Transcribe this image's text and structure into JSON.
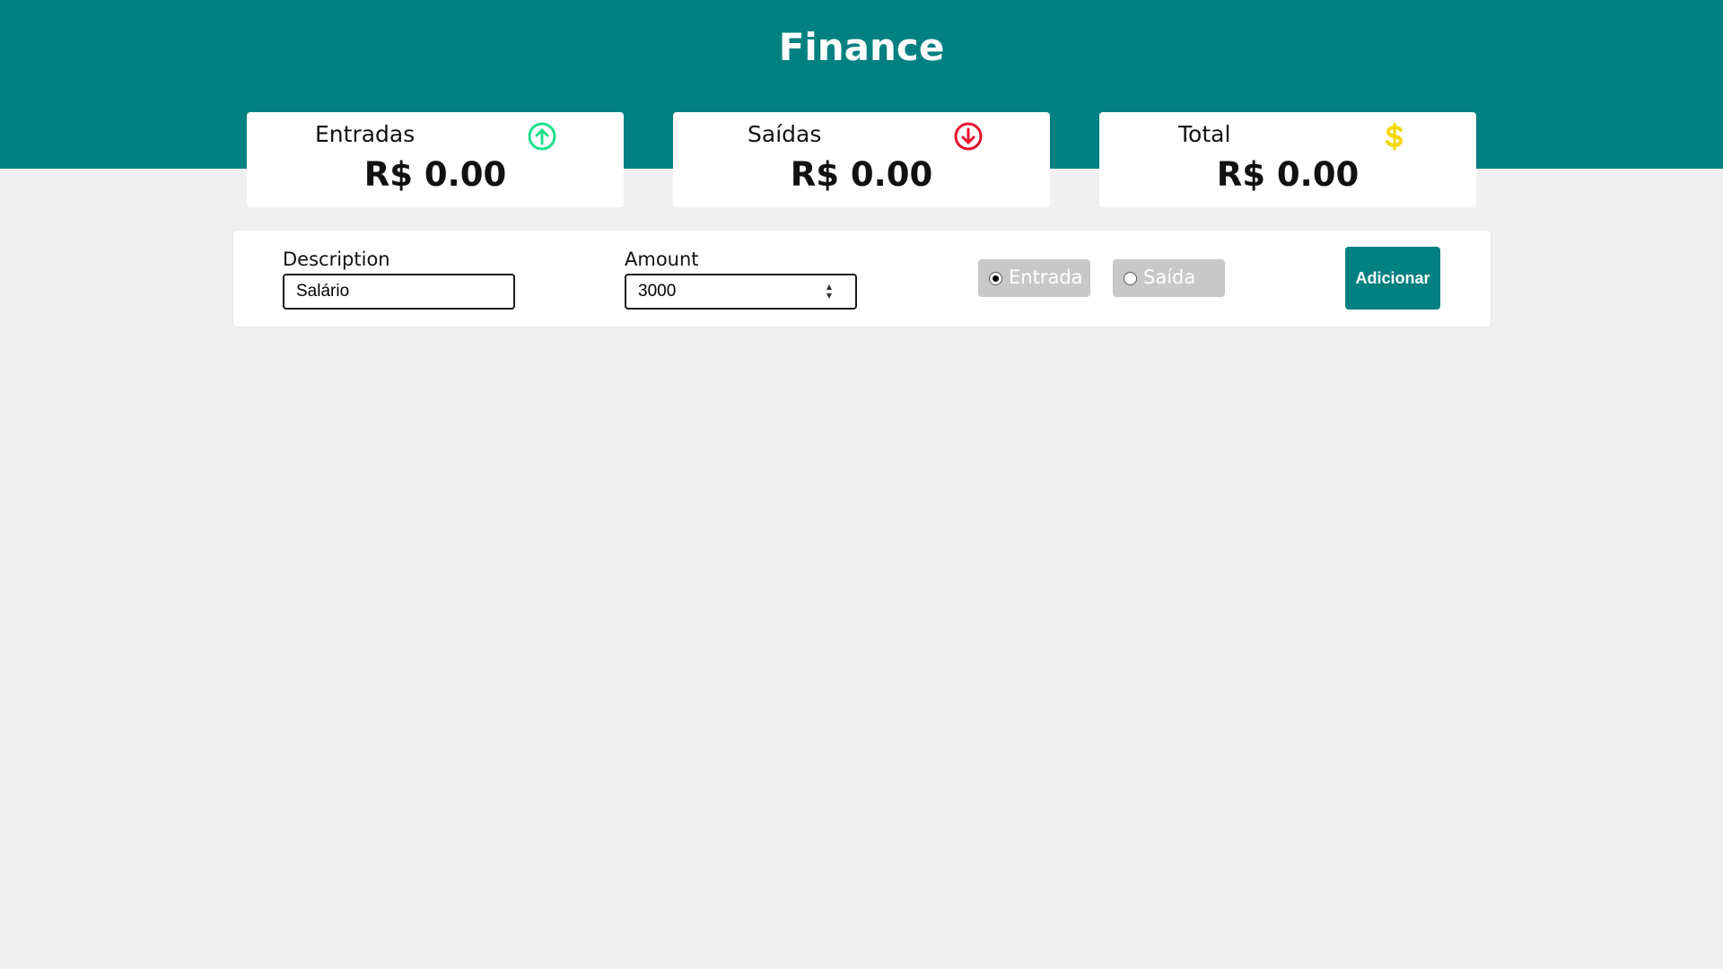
{
  "header": {
    "title": "Finance",
    "background_color": "#008080"
  },
  "summary": {
    "cards": [
      {
        "label": "Entradas",
        "value": "R$ 0.00",
        "icon": "arrow-up-circle-icon",
        "icon_color": "#1fe08a"
      },
      {
        "label": "Saídas",
        "value": "R$ 0.00",
        "icon": "arrow-down-circle-icon",
        "icon_color": "#e8112d"
      },
      {
        "label": "Total",
        "value": "R$ 0.00",
        "icon": "dollar-sign-icon",
        "icon_color": "#f3d800"
      }
    ]
  },
  "form": {
    "description_label": "Description",
    "description_value": "Salário",
    "amount_label": "Amount",
    "amount_value": "3000",
    "type_options": [
      {
        "label": "Entrada",
        "selected": true
      },
      {
        "label": "Saída",
        "selected": false
      }
    ],
    "submit_label": "Adicionar"
  }
}
